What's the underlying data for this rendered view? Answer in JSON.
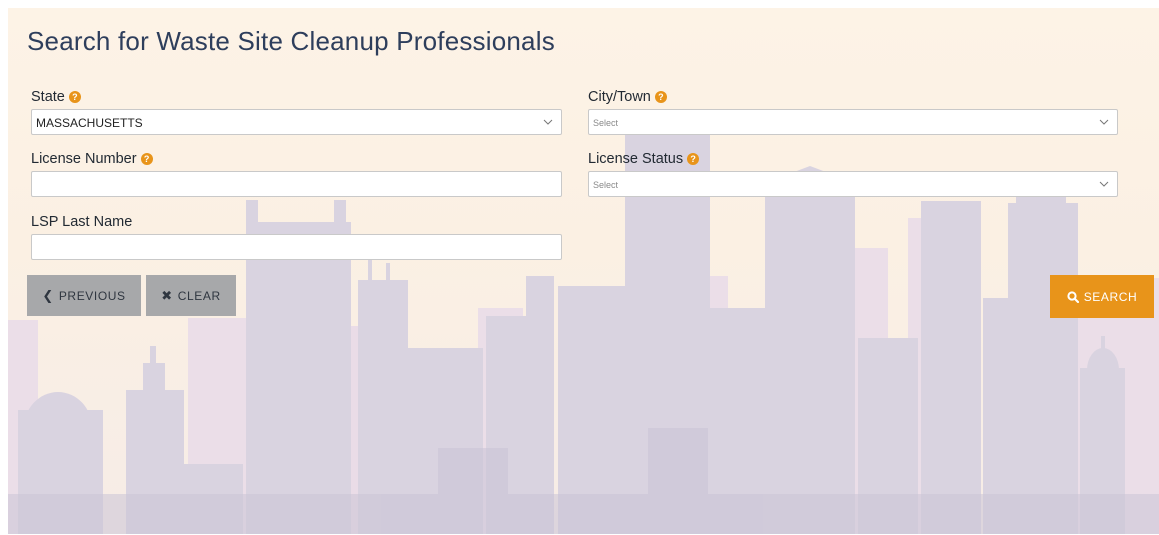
{
  "page": {
    "title": "Search for Waste Site Cleanup Professionals"
  },
  "form": {
    "state": {
      "label": "State",
      "value": "MASSACHUSETTS"
    },
    "city": {
      "label": "City/Town",
      "placeholder": "Select"
    },
    "license_number": {
      "label": "License Number",
      "value": ""
    },
    "license_status": {
      "label": "License Status",
      "placeholder": "Select"
    },
    "lsp_last_name": {
      "label": "LSP Last Name",
      "value": ""
    }
  },
  "buttons": {
    "previous": {
      "label": "PREVIOUS",
      "icon": "chevron-left-icon"
    },
    "clear": {
      "label": "CLEAR",
      "icon": "x-icon"
    },
    "search": {
      "label": "SEARCH",
      "icon": "search-icon"
    }
  },
  "icons": {
    "help": "?"
  },
  "colors": {
    "accent": "#e8941a",
    "title": "#2e3e5c",
    "button_gray": "#a7a8aa"
  }
}
